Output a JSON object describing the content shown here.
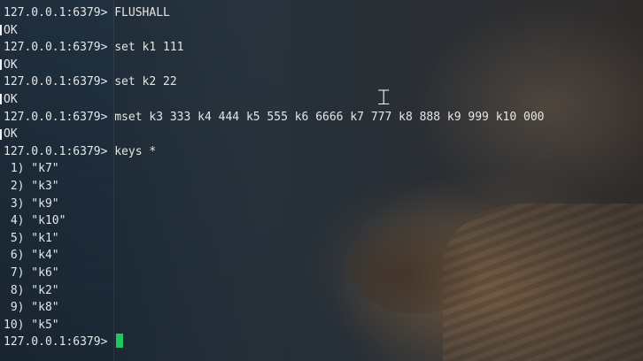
{
  "terminal": {
    "lines": [
      {
        "type": "command",
        "prompt": "127.0.0.1:6379>",
        "text": " FLUSHALL"
      },
      {
        "type": "output",
        "text": "OK"
      },
      {
        "type": "command",
        "prompt": "127.0.0.1:6379>",
        "text": " set k1 111"
      },
      {
        "type": "output",
        "text": "OK"
      },
      {
        "type": "command",
        "prompt": "127.0.0.1:6379>",
        "text": " set k2 22"
      },
      {
        "type": "output",
        "text": "OK"
      },
      {
        "type": "command",
        "prompt": "127.0.0.1:6379>",
        "text": " mset k3 333 k4 444 k5 555 k6 6666 k7 777 k8 888 k9 999 k10 000"
      },
      {
        "type": "output",
        "text": "OK"
      },
      {
        "type": "command",
        "prompt": "127.0.0.1:6379>",
        "text": " keys *"
      },
      {
        "type": "output",
        "text": " 1) \"k7\""
      },
      {
        "type": "output",
        "text": " 2) \"k3\""
      },
      {
        "type": "output",
        "text": " 3) \"k9\""
      },
      {
        "type": "output",
        "text": " 4) \"k10\""
      },
      {
        "type": "output",
        "text": " 5) \"k1\""
      },
      {
        "type": "output",
        "text": " 6) \"k4\""
      },
      {
        "type": "output",
        "text": " 7) \"k6\""
      },
      {
        "type": "output",
        "text": " 8) \"k2\""
      },
      {
        "type": "output",
        "text": " 9) \"k8\""
      },
      {
        "type": "output",
        "text": "10) \"k5\""
      }
    ],
    "current_prompt": "127.0.0.1:6379>",
    "cursor_color": "#22c55e"
  },
  "pointer": {
    "icon": "text-ibeam-cursor-icon"
  }
}
